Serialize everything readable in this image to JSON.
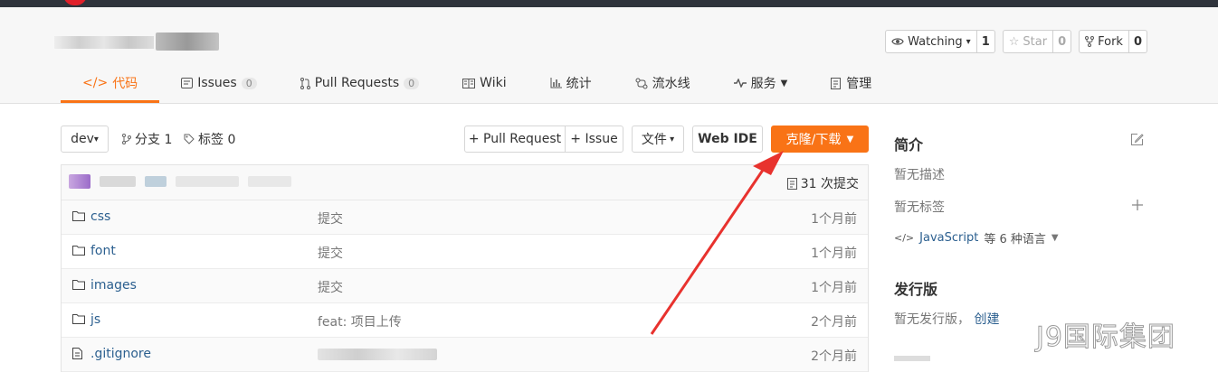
{
  "header": {
    "watch": {
      "label": "Watching",
      "count": "1"
    },
    "star": {
      "label": "Star",
      "count": "0"
    },
    "fork": {
      "label": "Fork",
      "count": "0"
    }
  },
  "tabs": [
    {
      "label": "代码",
      "icon": "code-icon"
    },
    {
      "label": "Issues",
      "badge": "0",
      "icon": "issue-icon"
    },
    {
      "label": "Pull Requests",
      "badge": "0",
      "icon": "pull-request-icon"
    },
    {
      "label": "Wiki",
      "icon": "book-icon"
    },
    {
      "label": "统计",
      "icon": "bar-chart-icon"
    },
    {
      "label": "流水线",
      "icon": "pipeline-icon"
    },
    {
      "label": "服务",
      "icon": "activity-icon"
    },
    {
      "label": "管理",
      "icon": "settings-doc-icon"
    }
  ],
  "toolbar": {
    "branch": "dev",
    "branches": "分支 1",
    "tags": "标签 0",
    "pull_request": "+ Pull Request",
    "issue": "+ Issue",
    "file": "文件",
    "web_ide": "Web IDE",
    "clone": "克隆/下载"
  },
  "commits": {
    "count": "31 次提交"
  },
  "files": [
    {
      "name": "css",
      "type": "folder",
      "message": "提交",
      "time": "1个月前"
    },
    {
      "name": "font",
      "type": "folder",
      "message": "提交",
      "time": "1个月前"
    },
    {
      "name": "images",
      "type": "folder",
      "message": "提交",
      "time": "1个月前"
    },
    {
      "name": "js",
      "type": "folder",
      "message": "feat: 项目上传",
      "time": "2个月前"
    },
    {
      "name": ".gitignore",
      "type": "file",
      "message": "",
      "time": "2个月前"
    }
  ],
  "sidebar": {
    "intro_title": "简介",
    "no_description": "暂无描述",
    "no_tags": "暂无标签",
    "language_prefix": "JavaScript",
    "language_suffix": "等 6 种语言",
    "release_title": "发行版",
    "no_release": "暂无发行版，",
    "create": "创建"
  },
  "watermark": "J9国际集团",
  "colors": {
    "accent": "#f97316",
    "link": "#2b5f8f",
    "arrow": "#e8322e"
  }
}
